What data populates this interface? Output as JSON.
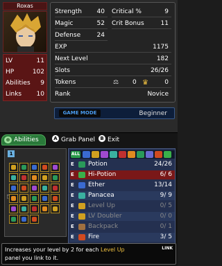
{
  "character": {
    "name": "Roxas",
    "stats": [
      {
        "label": "LV",
        "value": "11"
      },
      {
        "label": "HP",
        "value": "102"
      },
      {
        "label": "Abilities",
        "value": "9"
      },
      {
        "label": "Links",
        "value": "10"
      }
    ]
  },
  "stats": {
    "strength": {
      "label": "Strength",
      "value": "40"
    },
    "critical": {
      "label": "Critical %",
      "value": "9"
    },
    "magic": {
      "label": "Magic",
      "value": "52"
    },
    "crit_bonus": {
      "label": "Crit Bonus",
      "value": "11"
    },
    "defense": {
      "label": "Defense",
      "value": "24"
    },
    "exp": {
      "label": "EXP",
      "value": "1175"
    },
    "next_level": {
      "label": "Next Level",
      "value": "182"
    },
    "slots": {
      "label": "Slots",
      "value": "26/26"
    },
    "tokens": {
      "label": "Tokens",
      "value_a": "0",
      "value_b": "0"
    },
    "rank": {
      "label": "Rank",
      "value": "Novice"
    }
  },
  "game_mode": {
    "label": "GAME MODE",
    "value": "Beginner"
  },
  "nav": {
    "abilities_tab": "Abilities",
    "grab_button": "A",
    "grab_label": "Grab Panel",
    "exit_button": "B",
    "exit_label": "Exit"
  },
  "grid": {
    "number": "1"
  },
  "filter_all": "ALL",
  "items": [
    {
      "label": "Potion",
      "count": "24/26",
      "icon_color": "#2a9a5a",
      "selected": false,
      "dim": false
    },
    {
      "label": "Hi-Potion",
      "count": "6/ 6",
      "icon_color": "#3ab04a",
      "selected": true,
      "dim": false
    },
    {
      "label": "Ether",
      "count": "13/14",
      "icon_color": "#3a6ad0",
      "selected": false,
      "dim": false
    },
    {
      "label": "Panacea",
      "count": "9/ 9",
      "icon_color": "#3ab0a0",
      "selected": false,
      "dim": false
    },
    {
      "label": "Level Up",
      "count": "0/ 5",
      "icon_color": "#d0a020",
      "selected": false,
      "dim": true
    },
    {
      "label": "LV Doubler",
      "count": "0/ 0",
      "icon_color": "#d0a020",
      "selected": false,
      "dim": true
    },
    {
      "label": "Backpack",
      "count": "0/ 1",
      "icon_color": "#a07040",
      "selected": false,
      "dim": true
    },
    {
      "label": "Fire",
      "count": "3/ 5",
      "icon_color": "#d04a20",
      "selected": false,
      "dim": false
    }
  ],
  "help": {
    "text_1": "Increases your level by 2 for each ",
    "highlight": "Level Up",
    "text_2": "panel you link to it.",
    "link_badge": "LINK"
  },
  "colors": {
    "accent_green": "#2a7a3a",
    "list_blue": "#243050",
    "selected_red": "#7a1818",
    "highlight_gold": "#f0c040"
  }
}
